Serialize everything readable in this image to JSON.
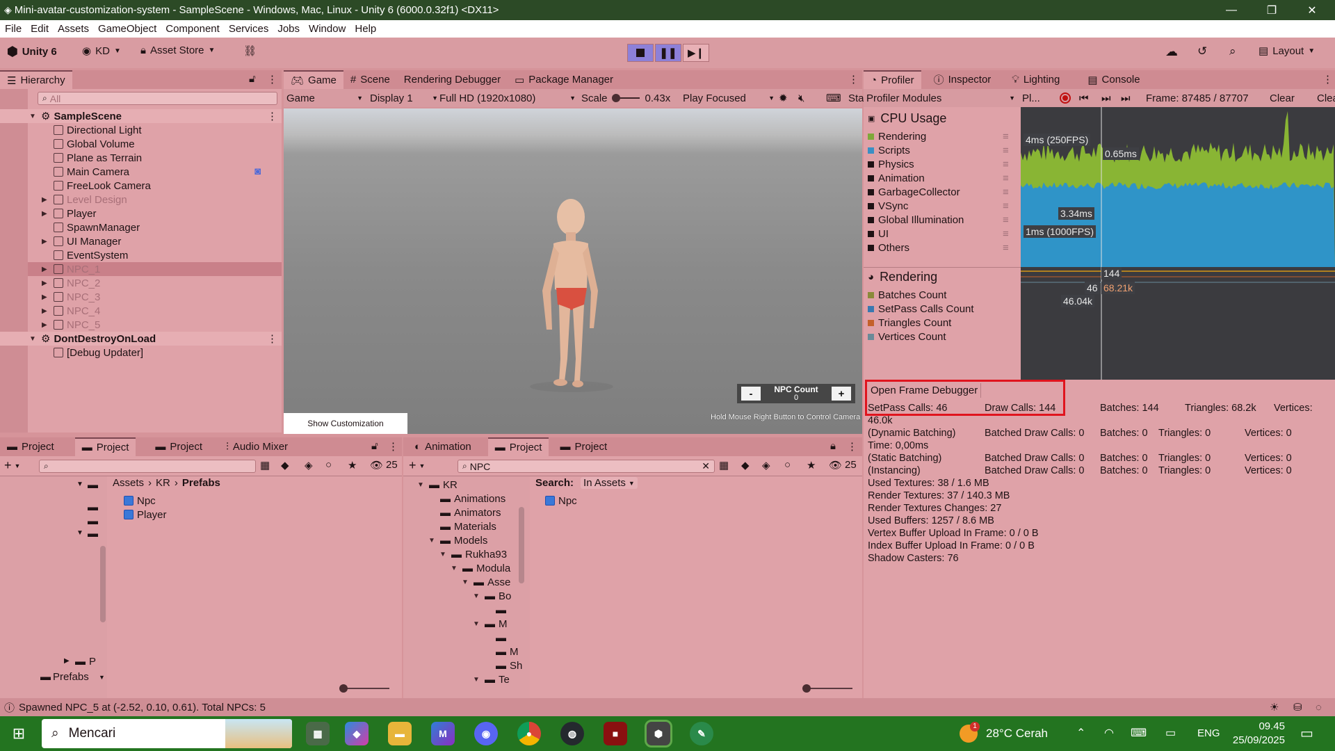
{
  "window": {
    "title": "Mini-avatar-customization-system - SampleScene - Windows, Mac, Linux - Unity 6 (6000.0.32f1) <DX11>"
  },
  "menu": [
    "File",
    "Edit",
    "Assets",
    "GameObject",
    "Component",
    "Services",
    "Jobs",
    "Window",
    "Help"
  ],
  "toolbar": {
    "unity_label": "Unity 6",
    "account": "KD",
    "asset_store": "Asset Store",
    "layout": "Layout"
  },
  "hierarchy": {
    "tab": "Hierarchy",
    "search_placeholder": "All",
    "items": [
      {
        "label": "SampleScene",
        "depth": 0,
        "type": "scene",
        "expanded": true
      },
      {
        "label": "Directional Light",
        "depth": 1
      },
      {
        "label": "Global Volume",
        "depth": 1
      },
      {
        "label": "Plane as Terrain",
        "depth": 1
      },
      {
        "label": "Main Camera",
        "depth": 1
      },
      {
        "label": "FreeLook Camera",
        "depth": 1
      },
      {
        "label": "Level Design",
        "depth": 1,
        "dim": true,
        "collapsed": true
      },
      {
        "label": "Player",
        "depth": 1,
        "collapsed": true
      },
      {
        "label": "SpawnManager",
        "depth": 1
      },
      {
        "label": "UI Manager",
        "depth": 1,
        "collapsed": true
      },
      {
        "label": "EventSystem",
        "depth": 1
      },
      {
        "label": "NPC_1",
        "depth": 1,
        "dim": true,
        "collapsed": true,
        "selected": true
      },
      {
        "label": "NPC_2",
        "depth": 1,
        "dim": true,
        "collapsed": true
      },
      {
        "label": "NPC_3",
        "depth": 1,
        "dim": true,
        "collapsed": true
      },
      {
        "label": "NPC_4",
        "depth": 1,
        "dim": true,
        "collapsed": true
      },
      {
        "label": "NPC_5",
        "depth": 1,
        "dim": true,
        "collapsed": true
      },
      {
        "label": "DontDestroyOnLoad",
        "depth": 0,
        "type": "scene",
        "expanded": true
      },
      {
        "label": "[Debug Updater]",
        "depth": 1
      }
    ]
  },
  "game": {
    "tabs": [
      "Game",
      "Scene",
      "Rendering Debugger",
      "Package Manager"
    ],
    "display_mode": "Game",
    "display": "Display 1",
    "resolution": "Full HD (1920x1080)",
    "scale_label": "Scale",
    "scale_value": "0.43x",
    "play_mode": "Play Focused",
    "stats_short": "Sta",
    "npc_count_label": "NPC Count",
    "npc_count_value": "0",
    "minus": "-",
    "plus": "+",
    "show_customization": "Show Customization",
    "hint": "Hold Mouse Right Button to Control Camera"
  },
  "profiler": {
    "tabs": [
      "Profiler",
      "Inspector",
      "Lighting",
      "Console"
    ],
    "modules_label": "Profiler Modules",
    "pl_short": "Pl...",
    "frame": "Frame: 87485 / 87707",
    "clear": "Clear",
    "clear2": "Clear",
    "cpu_title": "CPU Usage",
    "cpu_items": [
      {
        "label": "Rendering",
        "color": "#7fa83a"
      },
      {
        "label": "Scripts",
        "color": "#3b8fc4"
      },
      {
        "label": "Physics",
        "color": "#1e1214"
      },
      {
        "label": "Animation",
        "color": "#1e1214"
      },
      {
        "label": "GarbageCollector",
        "color": "#1e1214"
      },
      {
        "label": "VSync",
        "color": "#1e1214"
      },
      {
        "label": "Global Illumination",
        "color": "#1e1214"
      },
      {
        "label": "UI",
        "color": "#1e1214"
      },
      {
        "label": "Others",
        "color": "#1e1214"
      }
    ],
    "rendering_title": "Rendering",
    "rendering_items": [
      {
        "label": "Batches Count",
        "color": "#8a8a3a"
      },
      {
        "label": "SetPass Calls Count",
        "color": "#3b78b0"
      },
      {
        "label": "Triangles Count",
        "color": "#c4602a"
      },
      {
        "label": "Vertices Count",
        "color": "#6a8a98"
      }
    ],
    "graph_tags": {
      "fps250": "4ms (250FPS)",
      "v065": "0.65ms",
      "v334": "3.34ms",
      "fps1000": "1ms (1000FPS)",
      "r144": "144",
      "r46": "46",
      "r6821": "68.21k",
      "r4604": "46.04k"
    },
    "open_frame_debugger": "Open Frame Debugger",
    "stats": {
      "setpass": "SetPass Calls: 46",
      "draw": "Draw Calls: 144",
      "batches": "Batches: 144",
      "triangles": "Triangles: 68.2k",
      "vertices": "Vertices:",
      "vertices_val": "46.0k",
      "dyn": "(Dynamic Batching)",
      "dyn_draw": "Batched Draw Calls: 0",
      "dyn_batches": "Batches: 0",
      "dyn_tri": "Triangles: 0",
      "dyn_vert": "Vertices: 0",
      "time": "Time: 0,00ms",
      "stat": "(Static Batching)",
      "stat_draw": "Batched Draw Calls: 0",
      "stat_batches": "Batches: 0",
      "stat_tri": "Triangles: 0",
      "stat_vert": "Vertices: 0",
      "inst": "(Instancing)",
      "inst_draw": "Batched Draw Calls: 0",
      "inst_batches": "Batches: 0",
      "inst_tri": "Triangles: 0",
      "inst_vert": "Vertices: 0",
      "lines": [
        "Used Textures: 38 / 1.6 MB",
        "Render Textures: 37 / 140.3 MB",
        "Render Textures Changes: 27",
        "Used Buffers: 1257 / 8.6 MB",
        "Vertex Buffer Upload In Frame: 0 / 0 B",
        "Index Buffer Upload In Frame: 0 / 0 B",
        "Shadow Casters: 76"
      ]
    }
  },
  "project_left": {
    "tabs": [
      "Project",
      "Project",
      "Project",
      "Audio Mixer"
    ],
    "breadcrumb": [
      "Assets",
      "KR",
      "Prefabs"
    ],
    "items": [
      "Npc",
      "Player"
    ],
    "count": "25",
    "folder_p": "P",
    "bottom_folder": "Prefabs"
  },
  "project_right": {
    "tabs": [
      "Animation",
      "Project",
      "Project"
    ],
    "search_value": "NPC",
    "count": "25",
    "search_label": "Search:",
    "search_scope": "In Assets",
    "result": "Npc",
    "tree": [
      "KR",
      "Animations",
      "Animators",
      "Materials",
      "Models",
      "Rukha93",
      "Modula",
      "Asse",
      "Bo",
      "",
      "M",
      "",
      "M",
      "Sh",
      "Te"
    ]
  },
  "status": {
    "message": "Spawned NPC_5 at (-2.52, 0.10, 0.61). Total NPCs: 5"
  },
  "taskbar": {
    "search": "Mencari",
    "weather": "28°C Cerah",
    "lang": "ENG",
    "time": "09.45",
    "date": "25/09/2025",
    "notif_count": "1"
  }
}
